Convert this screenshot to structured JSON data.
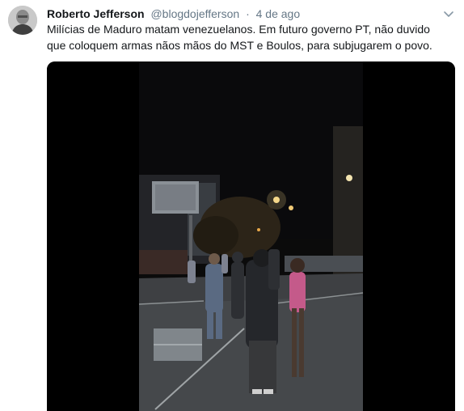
{
  "tweet": {
    "author_name": "Roberto Jefferson",
    "handle": "@blogdojefferson",
    "separator": "·",
    "time": "4 de ago",
    "text": "Milícias de Maduro matam venezuelanos. Em futuro governo PT, não duvido que coloquem armas nãos mãos do MST e Boulos, para subjugarem o povo."
  },
  "icons": {
    "menu": "chevron-down-icon",
    "avatar": "profile-photo"
  },
  "colors": {
    "name": "#14171a",
    "meta": "#657786",
    "media_background": "#000000"
  }
}
